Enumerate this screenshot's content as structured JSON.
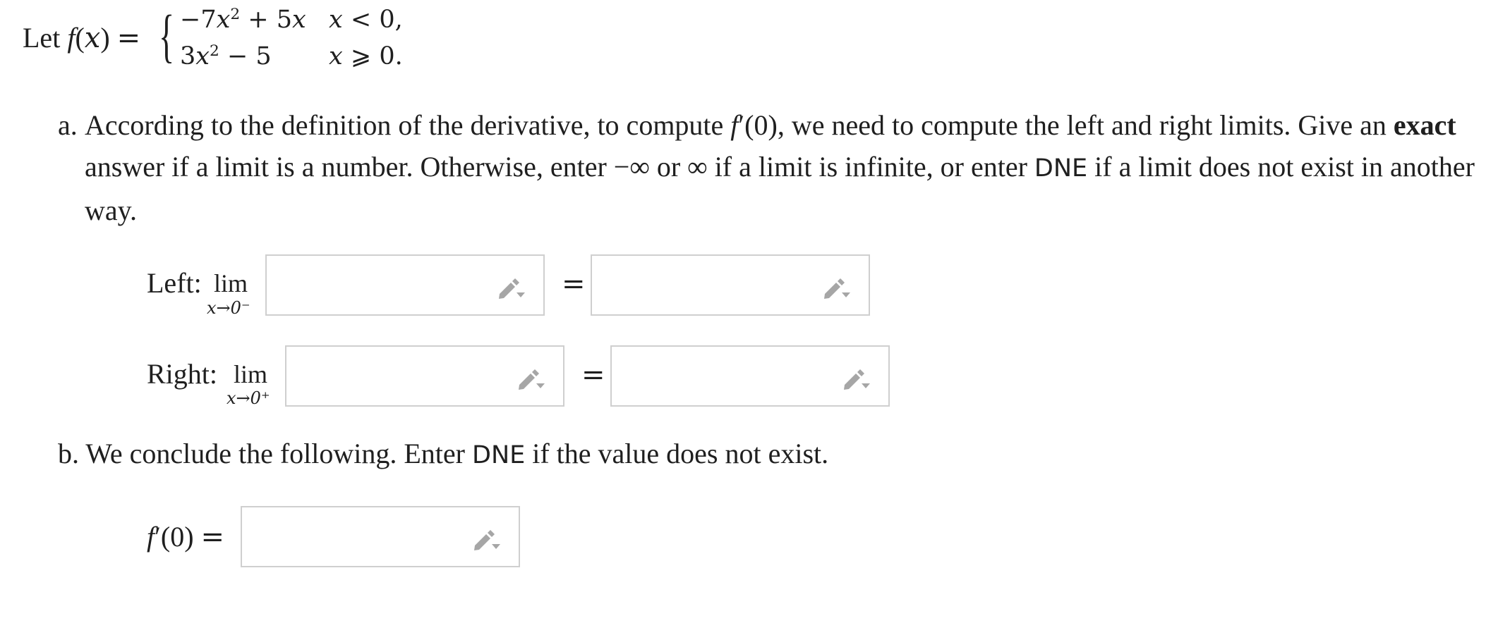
{
  "function_definition": {
    "intro": "Let",
    "name": "f",
    "arg": "x",
    "equals": "=",
    "cases": [
      {
        "expr_a": "−7",
        "var_a": "x",
        "exp_a": "2",
        "expr_b": " + 5",
        "var_b": "x",
        "cond_var": "x",
        "cond": " < 0,"
      },
      {
        "expr_a": "3",
        "var_a": "x",
        "exp_a": "2",
        "expr_b": " − 5",
        "cond_var": "x",
        "cond": " ⩾ 0."
      }
    ]
  },
  "part_a": {
    "marker": "a.",
    "text1": "According to the definition of the derivative, to compute ",
    "fprime": "f",
    "fprime_arg": "′(0)",
    "text2": ", we need to compute the left and right limits. Give an ",
    "bold": "exact",
    "text3": " answer if a limit is a number. Otherwise, enter −∞ or ∞ if a limit is infinite, or enter ",
    "dne": "DNE",
    "text4": " if a limit does not exist in another way."
  },
  "left_row": {
    "label": "Left:",
    "lim": "lim",
    "sub": "x→0⁻",
    "eq": "=",
    "expr_value": "",
    "result_value": ""
  },
  "right_row": {
    "label": "Right:",
    "lim": "lim",
    "sub": "x→0⁺",
    "eq": "=",
    "expr_value": "",
    "result_value": ""
  },
  "part_b": {
    "marker": "b.",
    "text1": "We conclude the following. Enter ",
    "dne": "DNE",
    "text2": " if the value does not exist."
  },
  "fprime_row": {
    "f": "f",
    "arg": "′(0)",
    "eq": "=",
    "value": ""
  },
  "icons": {
    "answer_tool": "pencil-dropdown-icon",
    "icon_color": "#a6a6a6"
  }
}
